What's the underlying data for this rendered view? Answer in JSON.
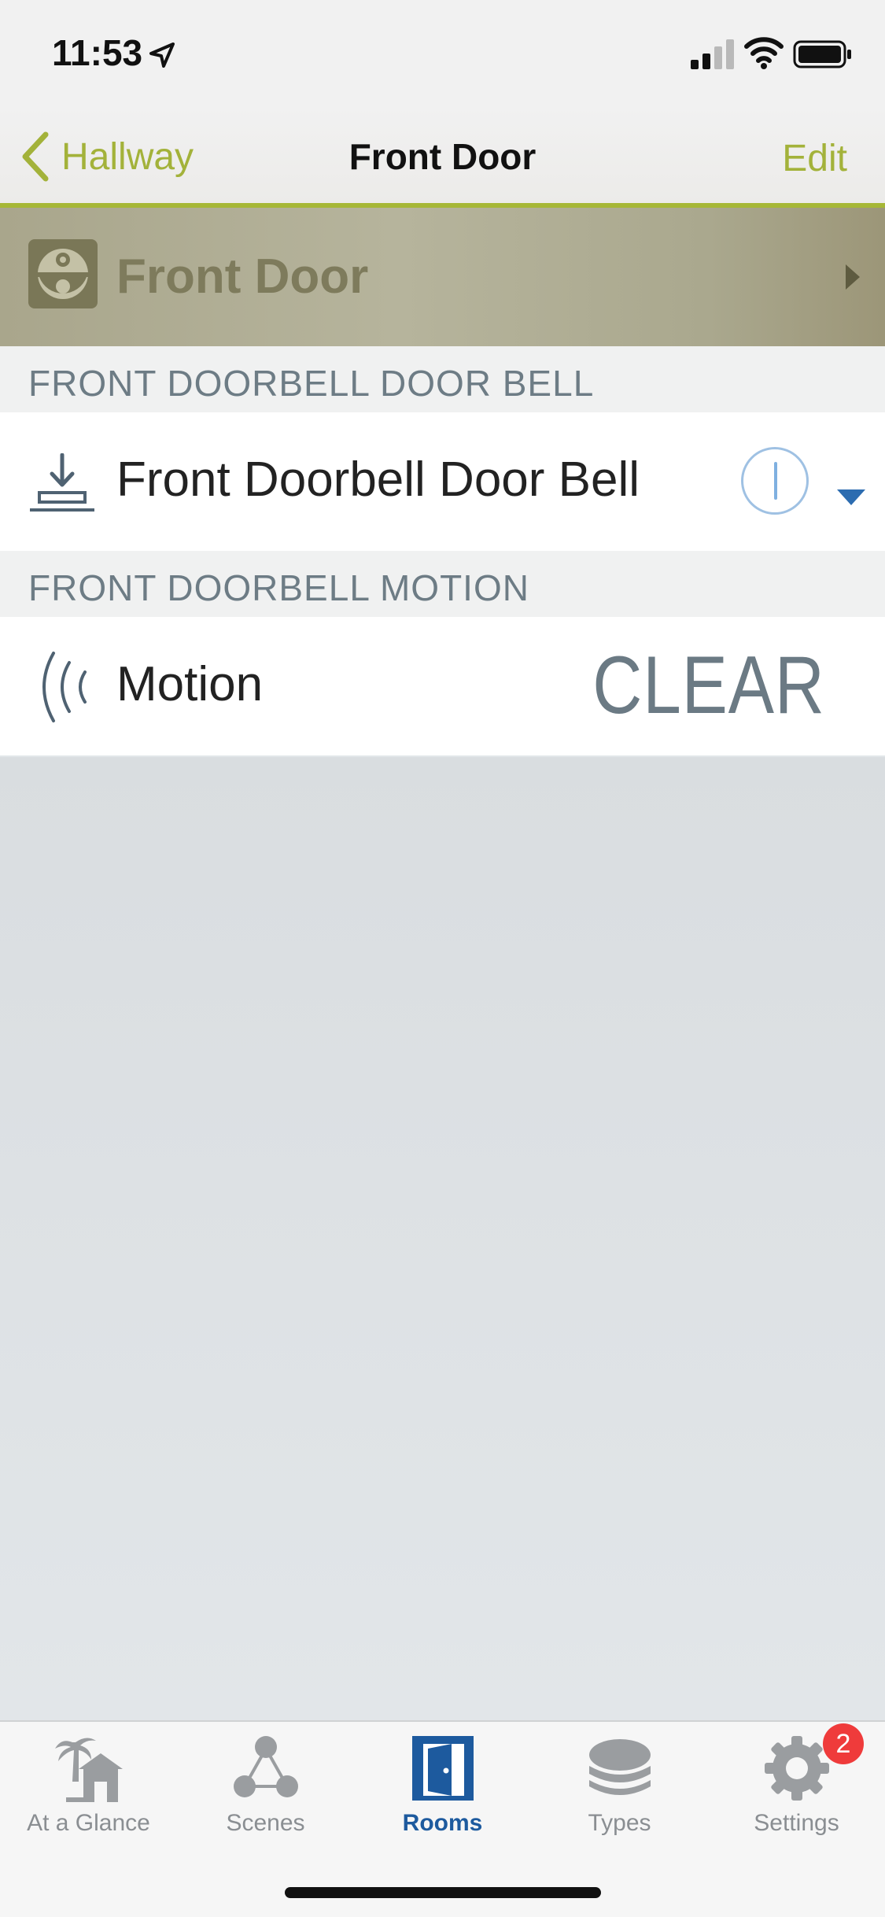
{
  "status_bar": {
    "time": "11:53"
  },
  "nav": {
    "back_label": "Hallway",
    "title": "Front Door",
    "edit_label": "Edit"
  },
  "room": {
    "name": "Front Door"
  },
  "sections": [
    {
      "header": "FRONT DOORBELL DOOR BELL",
      "device": {
        "label": "Front Doorbell Door Bell",
        "icon": "doorbell-press-icon",
        "control": "power-toggle"
      }
    },
    {
      "header": "FRONT DOORBELL MOTION",
      "device": {
        "label": "Motion",
        "icon": "motion-waves-icon",
        "status": "CLEAR"
      }
    }
  ],
  "tabs": [
    {
      "label": "At a Glance",
      "icon": "palm-house-icon",
      "active": false
    },
    {
      "label": "Scenes",
      "icon": "scenes-nodes-icon",
      "active": false
    },
    {
      "label": "Rooms",
      "icon": "door-icon",
      "active": true
    },
    {
      "label": "Types",
      "icon": "layers-icon",
      "active": false
    },
    {
      "label": "Settings",
      "icon": "gear-icon",
      "active": false,
      "badge": "2"
    }
  ],
  "colors": {
    "accent": "#a3b23a",
    "active_tab": "#1d5a9e",
    "badge": "#ef3b3b",
    "room_header": "#aaa88e"
  }
}
